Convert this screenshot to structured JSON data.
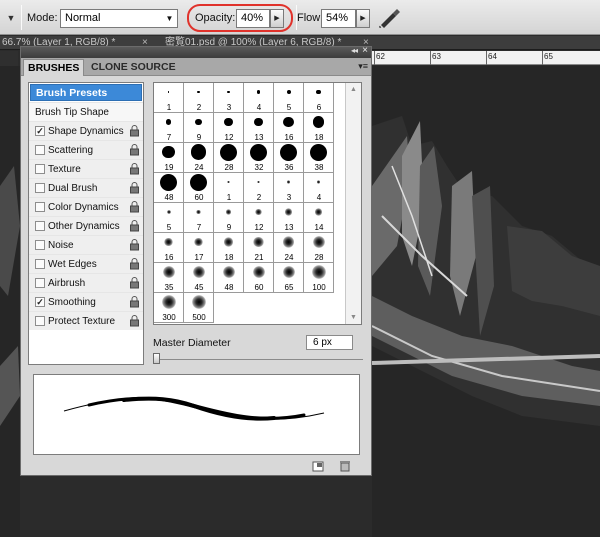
{
  "options_bar": {
    "tool_preset_arrow": "▼",
    "mode_label": "Mode:",
    "mode_value": "Normal",
    "opacity_label": "Opacity:",
    "opacity_value": "40%",
    "flow_label": "Flow:",
    "flow_value": "54%",
    "highlight_color": "#e0322b"
  },
  "document_tabs": [
    {
      "label": "66.7% (Layer 1, RGB/8) *"
    },
    {
      "label": "密覧01.psd @ 100% (Layer 6, RGB/8) *"
    }
  ],
  "ruler": {
    "labels": [
      "62",
      "63",
      "64",
      "65"
    ]
  },
  "panel": {
    "tabs": {
      "brushes": "BRUSHES",
      "clone_source": "CLONE SOURCE"
    },
    "brush_presets_label": "Brush Presets",
    "options": [
      {
        "label": "Brush Tip Shape",
        "checkbox": false,
        "checked": false,
        "lock": false
      },
      {
        "label": "Shape Dynamics",
        "checkbox": true,
        "checked": true,
        "lock": true
      },
      {
        "label": "Scattering",
        "checkbox": true,
        "checked": false,
        "lock": true
      },
      {
        "label": "Texture",
        "checkbox": true,
        "checked": false,
        "lock": true
      },
      {
        "label": "Dual Brush",
        "checkbox": true,
        "checked": false,
        "lock": true
      },
      {
        "label": "Color Dynamics",
        "checkbox": true,
        "checked": false,
        "lock": true
      },
      {
        "label": "Other Dynamics",
        "checkbox": true,
        "checked": false,
        "lock": true
      },
      {
        "label": "Noise",
        "checkbox": true,
        "checked": false,
        "lock": true
      },
      {
        "label": "Wet Edges",
        "checkbox": true,
        "checked": false,
        "lock": true
      },
      {
        "label": "Airbrush",
        "checkbox": true,
        "checked": false,
        "lock": true
      },
      {
        "label": "Smoothing",
        "checkbox": true,
        "checked": true,
        "lock": true
      },
      {
        "label": "Protect Texture",
        "checkbox": true,
        "checked": false,
        "lock": true
      }
    ],
    "presets": [
      {
        "size": "1",
        "kind": "hard"
      },
      {
        "size": "2",
        "kind": "hard"
      },
      {
        "size": "3",
        "kind": "hard"
      },
      {
        "size": "4",
        "kind": "hard"
      },
      {
        "size": "5",
        "kind": "hard"
      },
      {
        "size": "6",
        "kind": "hard"
      },
      {
        "size": "7",
        "kind": "hard"
      },
      {
        "size": "9",
        "kind": "hard"
      },
      {
        "size": "12",
        "kind": "hard"
      },
      {
        "size": "13",
        "kind": "hard"
      },
      {
        "size": "16",
        "kind": "hard"
      },
      {
        "size": "18",
        "kind": "hard"
      },
      {
        "size": "19",
        "kind": "hard"
      },
      {
        "size": "24",
        "kind": "hard"
      },
      {
        "size": "28",
        "kind": "hard"
      },
      {
        "size": "32",
        "kind": "hard"
      },
      {
        "size": "36",
        "kind": "hard"
      },
      {
        "size": "38",
        "kind": "hard"
      },
      {
        "size": "48",
        "kind": "hard"
      },
      {
        "size": "60",
        "kind": "hard"
      },
      {
        "size": "1",
        "kind": "soft"
      },
      {
        "size": "2",
        "kind": "soft"
      },
      {
        "size": "3",
        "kind": "soft"
      },
      {
        "size": "4",
        "kind": "soft"
      },
      {
        "size": "5",
        "kind": "soft"
      },
      {
        "size": "7",
        "kind": "soft"
      },
      {
        "size": "9",
        "kind": "soft"
      },
      {
        "size": "12",
        "kind": "soft"
      },
      {
        "size": "13",
        "kind": "soft"
      },
      {
        "size": "14",
        "kind": "soft"
      },
      {
        "size": "16",
        "kind": "soft"
      },
      {
        "size": "17",
        "kind": "soft"
      },
      {
        "size": "18",
        "kind": "soft"
      },
      {
        "size": "21",
        "kind": "soft"
      },
      {
        "size": "24",
        "kind": "soft"
      },
      {
        "size": "28",
        "kind": "soft"
      },
      {
        "size": "35",
        "kind": "soft"
      },
      {
        "size": "45",
        "kind": "soft"
      },
      {
        "size": "48",
        "kind": "soft"
      },
      {
        "size": "60",
        "kind": "soft"
      },
      {
        "size": "65",
        "kind": "soft"
      },
      {
        "size": "100",
        "kind": "soft"
      },
      {
        "size": "300",
        "kind": "soft"
      },
      {
        "size": "500",
        "kind": "soft"
      }
    ],
    "master_diameter_label": "Master Diameter",
    "master_diameter_value": "6 px",
    "master_diameter_slider": 0.0
  }
}
